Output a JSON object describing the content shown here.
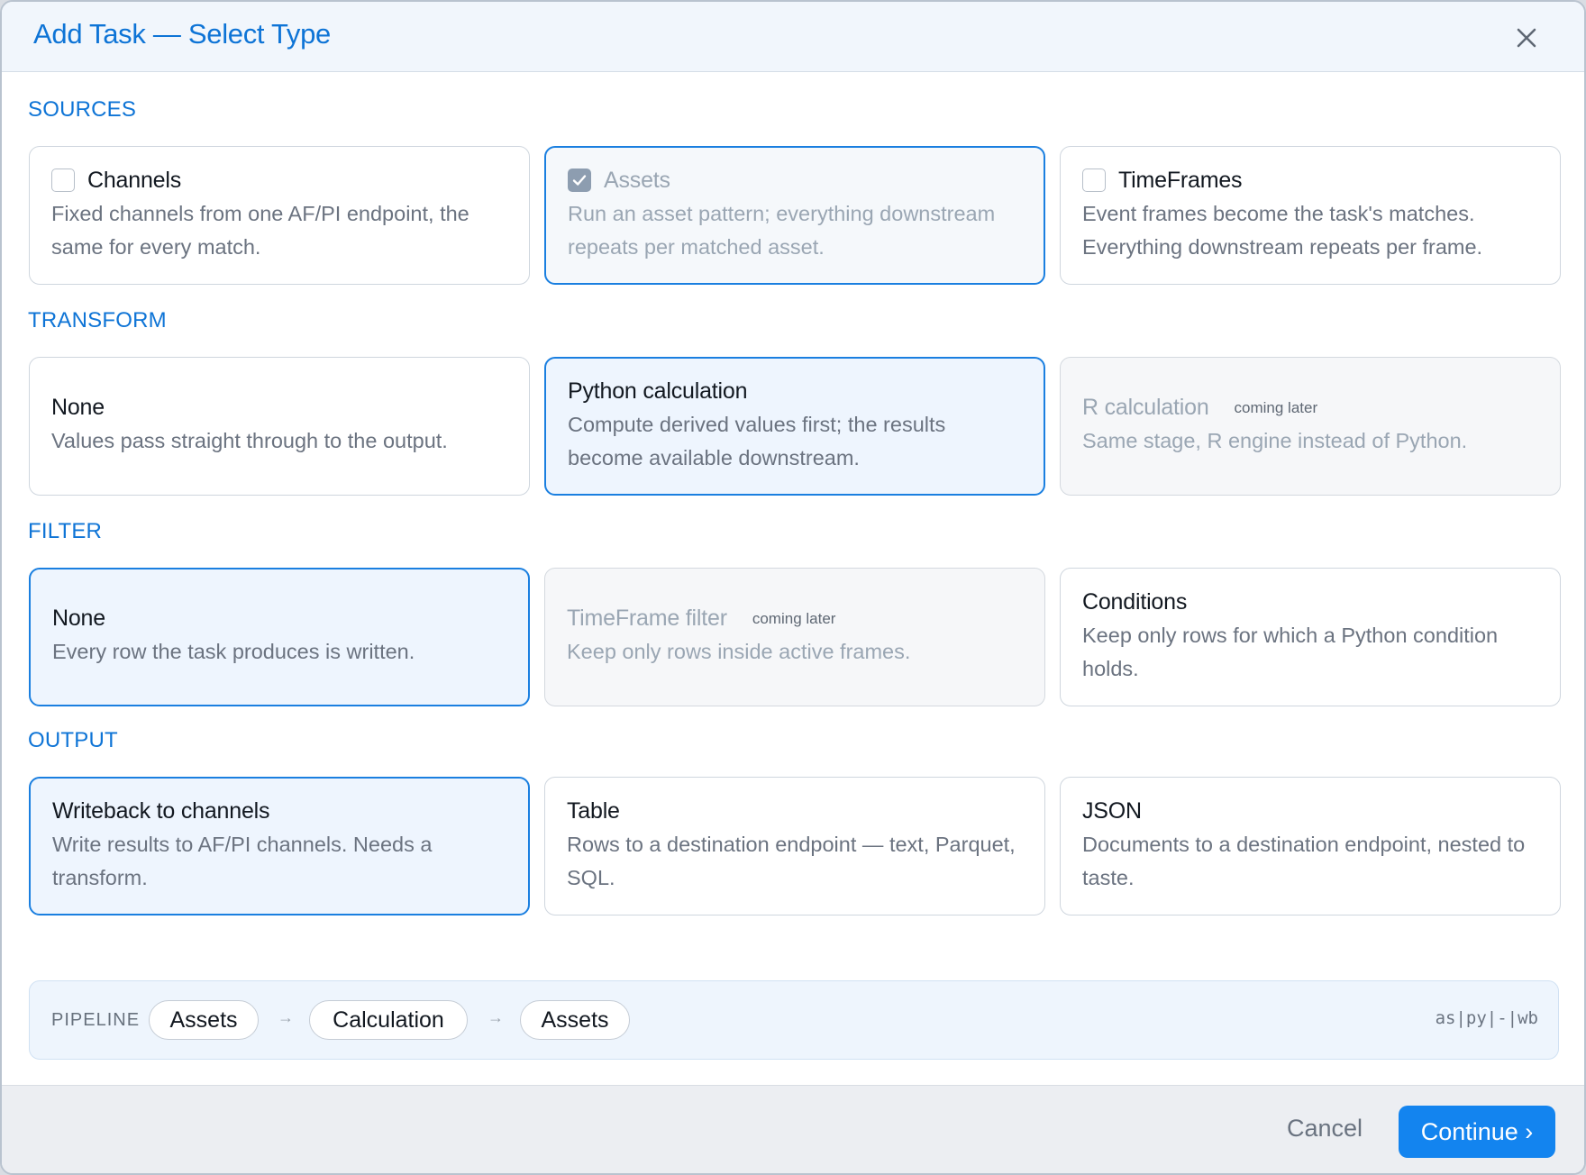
{
  "dialog": {
    "title": "Add Task — Select Type",
    "close_icon": "close-icon"
  },
  "sections": {
    "sources": {
      "label": "SOURCES",
      "cards": [
        {
          "title": "Channels",
          "desc": "Fixed channels from one AF/PI endpoint, the same for every match.",
          "checked": false
        },
        {
          "title": "Assets",
          "desc": "Run an asset pattern; everything downstream repeats per matched asset.",
          "checked": true
        },
        {
          "title": "TimeFrames",
          "desc": "Event frames become the task's matches. Everything downstream repeats per frame.",
          "checked": false
        }
      ]
    },
    "transform": {
      "label": "TRANSFORM",
      "cards": [
        {
          "title": "None",
          "desc": "Values pass straight through to the output."
        },
        {
          "title": "Python calculation",
          "desc": "Compute derived values first; the results become available downstream."
        },
        {
          "title": "R calculation",
          "badge": "coming later",
          "desc": "Same stage, R engine instead of Python."
        }
      ]
    },
    "filter": {
      "label": "FILTER",
      "cards": [
        {
          "title": "None",
          "desc": "Every row the task produces is written."
        },
        {
          "title": "TimeFrame filter",
          "badge": "coming later",
          "desc": "Keep only rows inside active frames."
        },
        {
          "title": "Conditions",
          "desc": "Keep only rows for which a Python condition holds."
        }
      ]
    },
    "output": {
      "label": "OUTPUT",
      "cards": [
        {
          "title": "Writeback to channels",
          "desc": "Write results to AF/PI channels. Needs a transform."
        },
        {
          "title": "Table",
          "desc": "Rows to a destination endpoint — text, Parquet, SQL."
        },
        {
          "title": "JSON",
          "desc": "Documents to a destination endpoint, nested to taste."
        }
      ]
    }
  },
  "pipeline": {
    "label": "PIPELINE",
    "steps": [
      "Assets",
      "Calculation",
      "Assets"
    ],
    "arrow": "→",
    "code": "as|py|-|wb"
  },
  "footer": {
    "cancel_label": "Cancel",
    "continue_label": "Continue ›"
  },
  "colors": {
    "accent": "#0e74d6",
    "selected_bg": "#eef5fe",
    "primary_button": "#1384ef"
  }
}
